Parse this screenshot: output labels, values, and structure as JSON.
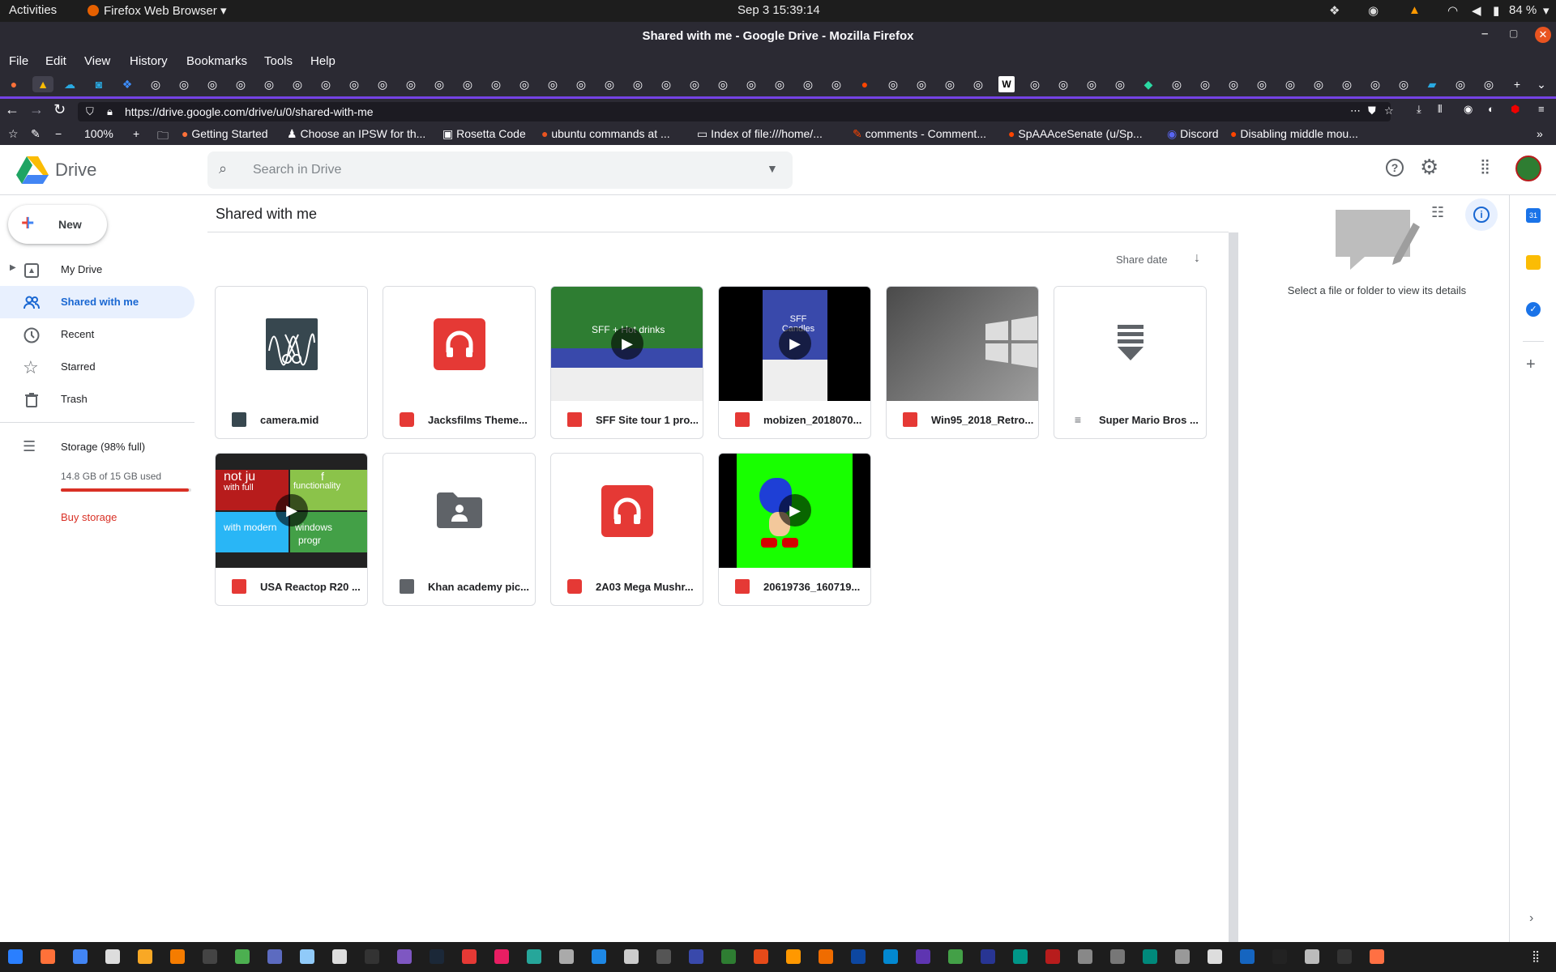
{
  "system": {
    "activities": "Activities",
    "app_menu": "Firefox Web Browser",
    "datetime": "Sep 3  15:39:14",
    "battery": "84 %"
  },
  "window": {
    "title": "Shared with me - Google Drive - Mozilla Firefox"
  },
  "menu": [
    "File",
    "Edit",
    "View",
    "History",
    "Bookmarks",
    "Tools",
    "Help"
  ],
  "url": "https://drive.google.com/drive/u/0/shared-with-me",
  "zoom": "100%",
  "bookmarks": [
    "Getting Started",
    "Choose an IPSW for th...",
    "Rosetta Code",
    "ubuntu commands at ...",
    "Index of file:///home/...",
    "comments - Comment...",
    "SpAAAceSenate (u/Sp...",
    "Discord",
    "Disabling middle mou..."
  ],
  "drive": {
    "logo_text": "Drive",
    "search_placeholder": "Search in Drive",
    "new_button": "New",
    "nav": [
      {
        "label": "My Drive"
      },
      {
        "label": "Shared with me"
      },
      {
        "label": "Recent"
      },
      {
        "label": "Starred"
      },
      {
        "label": "Trash"
      }
    ],
    "storage_label": "Storage (98% full)",
    "storage_used": "14.8 GB of 15 GB used",
    "storage_fraction": 0.98,
    "buy_storage": "Buy storage",
    "page_title": "Shared with me",
    "sort_label": "Share date",
    "details_empty": "Select a file or folder to view its details",
    "files": [
      {
        "name": "camera.mid",
        "type": "audio-mid"
      },
      {
        "name": "Jacksfilms Theme...",
        "type": "audio"
      },
      {
        "name": "SFF Site tour 1 pro...",
        "type": "video"
      },
      {
        "name": "mobizen_2018070...",
        "type": "video"
      },
      {
        "name": "Win95_2018_Retro...",
        "type": "image"
      },
      {
        "name": "Super Mario Bros ...",
        "type": "archive"
      },
      {
        "name": "USA Reactop R20 ...",
        "type": "video"
      },
      {
        "name": "Khan academy pic...",
        "type": "shared-folder"
      },
      {
        "name": "2A03 Mega Mushr...",
        "type": "audio"
      },
      {
        "name": "20619736_160719...",
        "type": "video"
      }
    ],
    "thumb_texts": {
      "sff": "SFF + Hot drinks",
      "mobizen": "SFF Candles",
      "usa_1": "not ju",
      "usa_2": "with full",
      "usa_3": "f",
      "usa_4": "functionality",
      "usa_5": "with modern",
      "usa_6": "windows",
      "usa_7": "progr"
    }
  },
  "colors": {
    "accent": "#1a73e8",
    "selected_nav": "#e8f0fe",
    "danger": "#d93025",
    "firefox_dark": "#2b2a33"
  }
}
